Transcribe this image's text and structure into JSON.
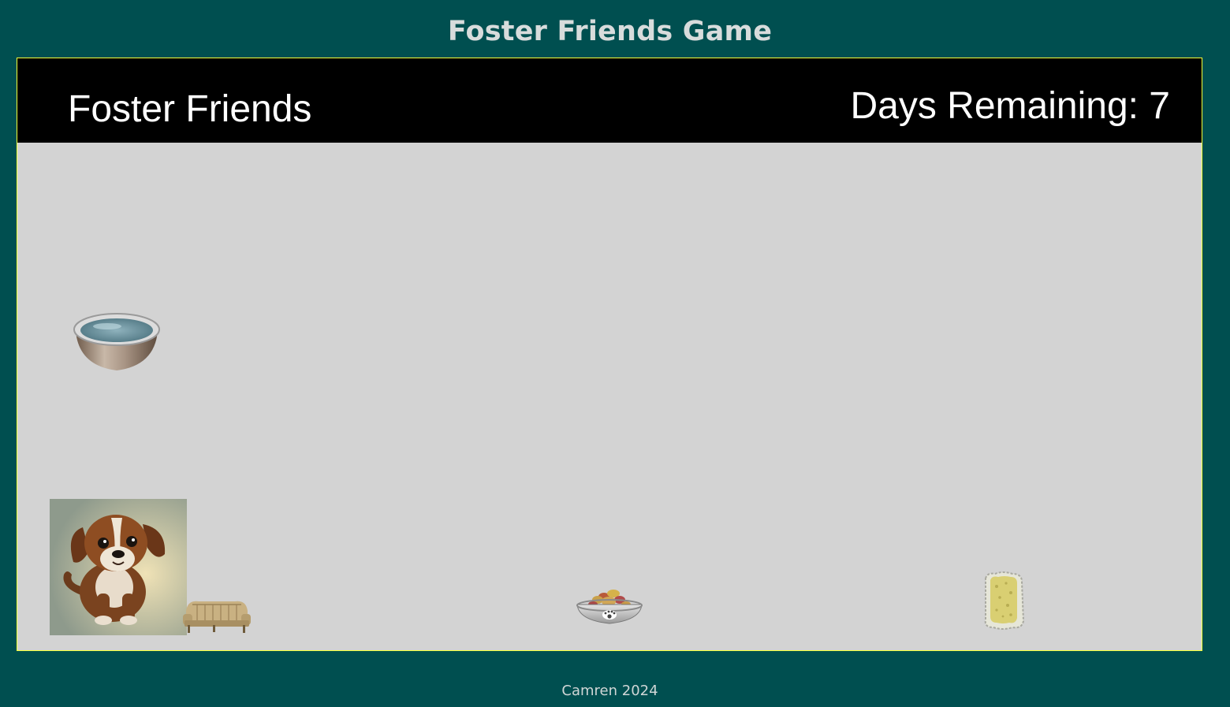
{
  "page": {
    "title": "Foster Friends Game",
    "footer": "Camren 2024"
  },
  "game": {
    "name": "Foster Friends",
    "days_label": "Days Remaining: 7",
    "days_remaining": 7,
    "items": [
      {
        "name": "water-bowl",
        "icon": "water-bowl-icon"
      },
      {
        "name": "dog",
        "icon": "puppy-icon"
      },
      {
        "name": "dog-bed",
        "icon": "couch-bed-icon"
      },
      {
        "name": "food-bowl",
        "icon": "food-bowl-icon"
      },
      {
        "name": "sponge",
        "icon": "sponge-icon"
      }
    ]
  },
  "colors": {
    "page_background": "#004f50",
    "frame_border": "#f4ff3a",
    "play_area": "#d3d3d3",
    "hud_background": "#000000",
    "hud_text": "#ffffff",
    "title_text": "#d8dcdc"
  }
}
